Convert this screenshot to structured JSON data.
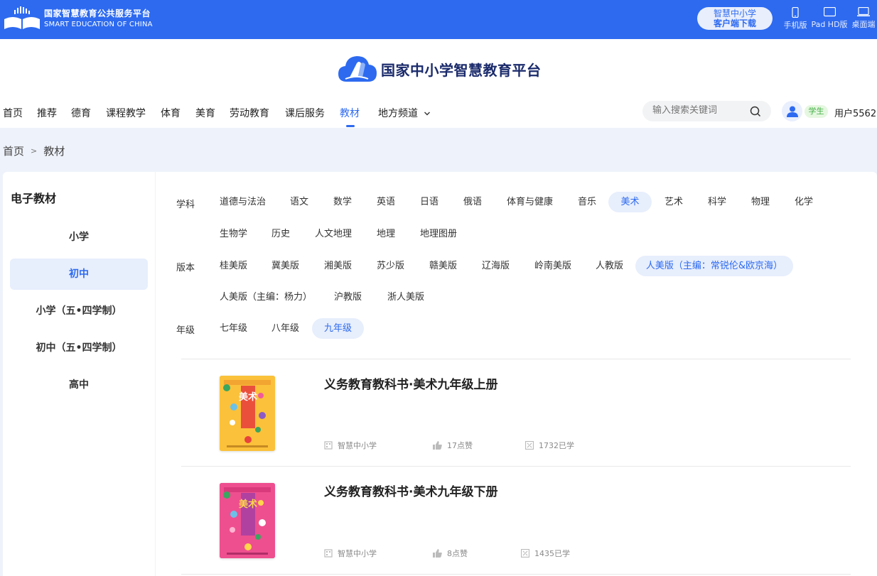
{
  "topbar": {
    "brand_cn": "国家智慧教育公共服务平台",
    "brand_en": "SMART EDUCATION OF CHINA",
    "download_line1": "智慧中小学",
    "download_line2": "客户端下载",
    "devices": [
      {
        "label": "手机版",
        "icon": "phone-icon"
      },
      {
        "label": "Pad HD版",
        "icon": "tablet-icon"
      },
      {
        "label": "桌面端",
        "icon": "laptop-icon"
      }
    ]
  },
  "header": {
    "site_title": "国家中小学智慧教育平台",
    "nav": [
      "首页",
      "推荐",
      "德育",
      "课程教学",
      "体育",
      "美育",
      "劳动教育",
      "课后服务",
      "教材",
      "地方频道"
    ],
    "active_nav": "教材",
    "search_placeholder": "输入搜索关键词",
    "role_badge": "学生",
    "username": "用户5562"
  },
  "breadcrumb": [
    "首页",
    "教材"
  ],
  "sidebar": {
    "title": "电子教材",
    "items": [
      "小学",
      "初中",
      "小学（五•四学制）",
      "初中（五•四学制）",
      "高中"
    ],
    "selected": "初中"
  },
  "filters": {
    "subject_label": "学科",
    "subjects": [
      "道德与法治",
      "语文",
      "数学",
      "英语",
      "日语",
      "俄语",
      "体育与健康",
      "音乐",
      "美术",
      "艺术",
      "科学",
      "物理",
      "化学",
      "生物学",
      "历史",
      "人文地理",
      "地理",
      "地理图册"
    ],
    "subject_selected": "美术",
    "edition_label": "版本",
    "editions": [
      "桂美版",
      "冀美版",
      "湘美版",
      "苏少版",
      "赣美版",
      "辽海版",
      "岭南美版",
      "人教版",
      "人美版（主编：常锐伦&欧京海）",
      "人美版（主编：杨力）",
      "沪教版",
      "浙人美版"
    ],
    "edition_selected": "人美版（主编：常锐伦&欧京海）",
    "grade_label": "年级",
    "grades": [
      "七年级",
      "八年级",
      "九年级"
    ],
    "grade_selected": "九年级"
  },
  "books": [
    {
      "title": "义务教育教科书·美术九年级上册",
      "publisher": "智慧中小学",
      "likes": "17点赞",
      "learned": "1732已学",
      "cover_text": "美术",
      "cover_color": "#f7b733"
    },
    {
      "title": "义务教育教科书·美术九年级下册",
      "publisher": "智慧中小学",
      "likes": "8点赞",
      "learned": "1435已学",
      "cover_text": "美术",
      "cover_color": "#e83e8c"
    }
  ],
  "colors": {
    "brand_blue": "#2d6af0",
    "selected_bg": "#e7eefc",
    "student_green": "#44b047"
  }
}
